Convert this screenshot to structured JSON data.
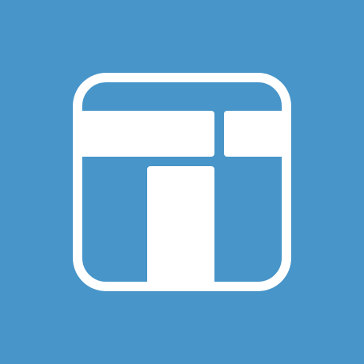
{
  "logo": {
    "icon_name": "app-logo-icon",
    "colors": {
      "background": "#4795c9",
      "foreground": "#ffffff"
    }
  }
}
